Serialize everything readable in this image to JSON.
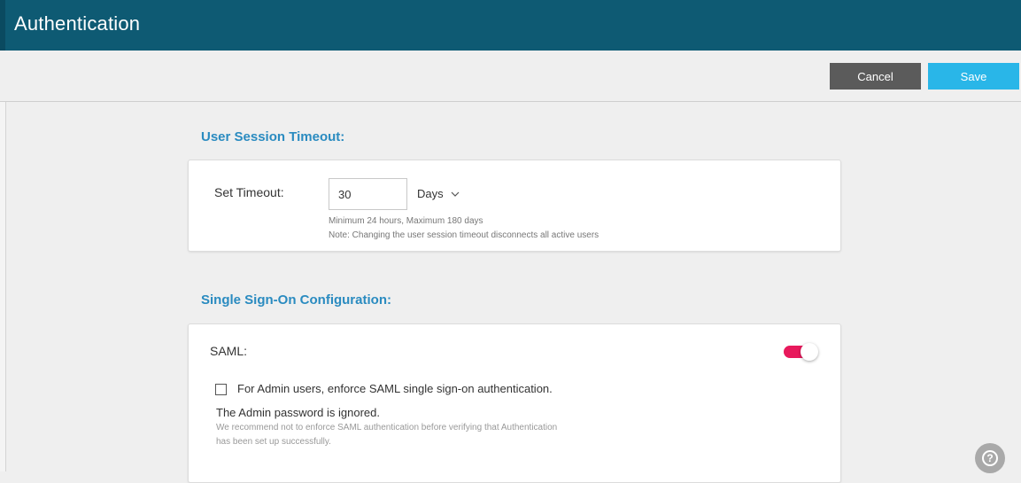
{
  "header": {
    "title": "Authentication"
  },
  "toolbar": {
    "cancel_label": "Cancel",
    "save_label": "Save"
  },
  "session_timeout": {
    "section_title": "User Session Timeout:",
    "label": "Set Timeout:",
    "value": "30",
    "unit": "Days",
    "hint_range": "Minimum 24 hours, Maximum 180 days",
    "hint_note": "Note: Changing the user session timeout disconnects all active users"
  },
  "sso": {
    "section_title": "Single Sign-On Configuration:",
    "saml_label": "SAML:",
    "saml_enabled": true,
    "enforce_label": "For Admin users, enforce SAML single sign-on authentication.",
    "enforce_checked": false,
    "admin_note": "The Admin password is ignored.",
    "recommend_line1": "We recommend not to enforce SAML authentication before verifying that Authentication",
    "recommend_line2": "has been set up successfully."
  },
  "help": {
    "icon_glyph": "?"
  },
  "colors": {
    "header_bg": "#0e5a73",
    "accent": "#2a8bc0",
    "save_bg": "#29b6e8",
    "cancel_bg": "#5b5b5b",
    "toggle_on": "#e8195c"
  }
}
